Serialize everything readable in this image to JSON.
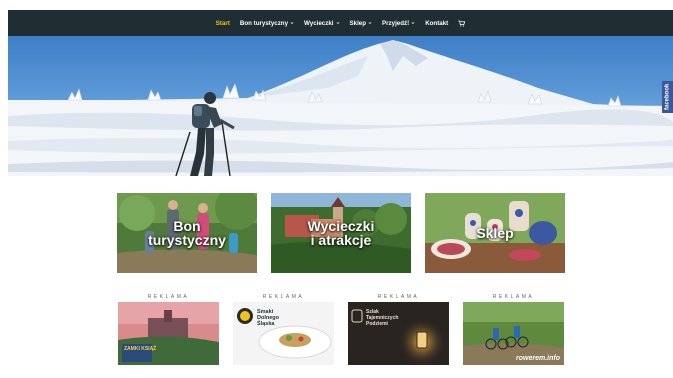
{
  "nav": {
    "items": [
      {
        "label": "Start",
        "active": true,
        "dropdown": false
      },
      {
        "label": "Bon turystyczny",
        "active": false,
        "dropdown": true
      },
      {
        "label": "Wycieczki",
        "active": false,
        "dropdown": true
      },
      {
        "label": "Sklep",
        "active": false,
        "dropdown": true
      },
      {
        "label": "Przyjedź!",
        "active": false,
        "dropdown": true
      },
      {
        "label": "Kontakt",
        "active": false,
        "dropdown": false
      }
    ],
    "cart_icon": "cart-icon",
    "chevron_icon": "chevron-down-icon"
  },
  "hero": {
    "facebook_tab": "facebook"
  },
  "tiles": [
    {
      "line1": "Bon",
      "line2": "turystyczny"
    },
    {
      "line1": "Wycieczki",
      "line2": "i atrakcje"
    },
    {
      "line1": "Sklep",
      "line2": ""
    }
  ],
  "ads": {
    "label": "REKLAMA",
    "items": [
      {
        "title1": "ZAMKI",
        "title2": "KSIĄŻ"
      },
      {
        "title1": "Smaki",
        "title2": "Dolnego",
        "title3": "Śląska"
      },
      {
        "title1": "Szlak",
        "title2": "Tajemniczych",
        "title3": "Podziemi"
      },
      {
        "title1": "rowerem.info"
      }
    ]
  },
  "colors": {
    "nav_bg": "#1e2e33",
    "nav_active": "#f2c11b",
    "facebook": "#3b5998"
  }
}
